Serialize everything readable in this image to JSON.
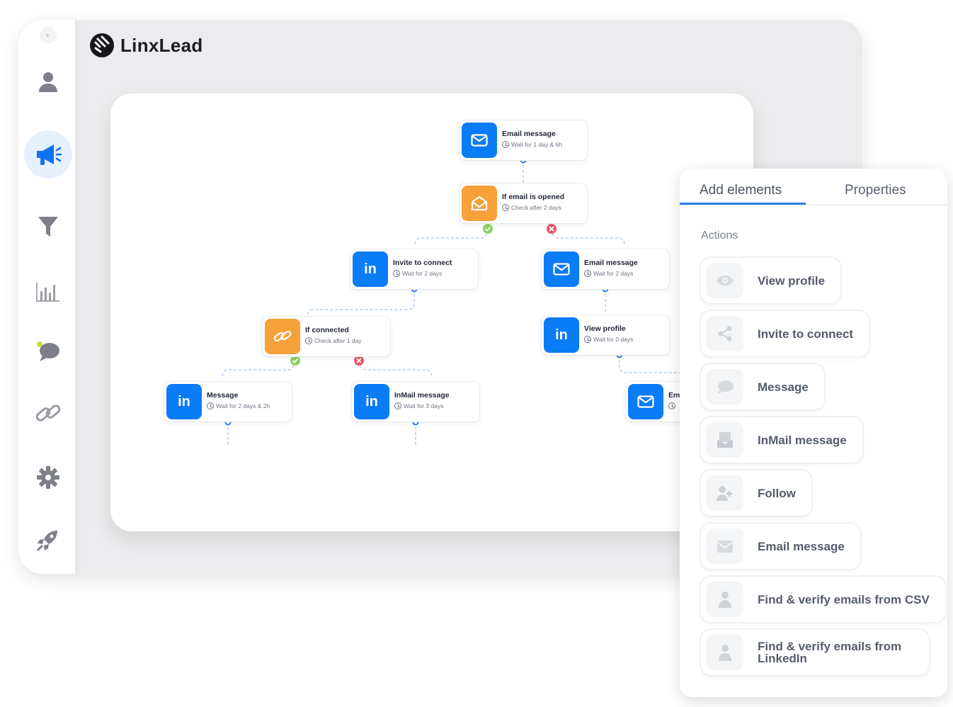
{
  "brand": {
    "name": "LinxLead"
  },
  "sidebar": {
    "items": [
      {
        "name": "contacts",
        "icon": "user-icon"
      },
      {
        "name": "campaigns",
        "icon": "megaphone-icon",
        "active": true
      },
      {
        "name": "filters",
        "icon": "filter-icon"
      },
      {
        "name": "analytics",
        "icon": "bar-chart-icon"
      },
      {
        "name": "messages",
        "icon": "chat-icon"
      },
      {
        "name": "integrations",
        "icon": "link-icon"
      },
      {
        "name": "settings",
        "icon": "gear-icon"
      },
      {
        "name": "launch",
        "icon": "rocket-icon"
      }
    ]
  },
  "flow": {
    "nodes": [
      {
        "title": "Email message",
        "subtitle": "Wait for 1 day & 6h",
        "icon": "envelope-icon",
        "color": "#0a7cf6"
      },
      {
        "title": "If email is opened",
        "subtitle": "Check after 2 days",
        "icon": "open-envelope-icon",
        "color": "#f8a03a"
      },
      {
        "title": "Invite to connect",
        "subtitle": "Wait for 2 days",
        "icon": "linkedin-icon",
        "color": "#0a7cf6"
      },
      {
        "title": "Email message",
        "subtitle": "Wait for 2 days",
        "icon": "envelope-icon",
        "color": "#0a7cf6"
      },
      {
        "title": "If connected",
        "subtitle": "Check after 1 day",
        "icon": "link-icon",
        "color": "#f8a03a"
      },
      {
        "title": "View profile",
        "subtitle": "Wait for 0 days",
        "icon": "linkedin-icon",
        "color": "#0a7cf6"
      },
      {
        "title": "Message",
        "subtitle": "Wait for 2 days & 2h",
        "icon": "linkedin-icon",
        "color": "#0a7cf6"
      },
      {
        "title": "InMail message",
        "subtitle": "Wait for 3 days",
        "icon": "linkedin-icon",
        "color": "#0a7cf6"
      },
      {
        "title": "Em",
        "subtitle": "",
        "icon": "envelope-icon",
        "color": "#0a7cf6"
      }
    ],
    "linkedin_glyph": "in",
    "yes_color": "#8dd35f",
    "no_color": "#e5576a"
  },
  "panel": {
    "tabs": [
      {
        "label": "Add elements",
        "active": true
      },
      {
        "label": "Properties",
        "active": false
      }
    ],
    "section_title": "Actions",
    "actions": [
      {
        "label": "View profile",
        "icon": "eye-icon"
      },
      {
        "label": "Invite to connect",
        "icon": "share-icon"
      },
      {
        "label": "Message",
        "icon": "chat-icon"
      },
      {
        "label": "InMail message",
        "icon": "inmail-icon"
      },
      {
        "label": "Follow",
        "icon": "follow-icon"
      },
      {
        "label": "Email message",
        "icon": "envelope-icon"
      },
      {
        "label": "Find & verify emails from CSV",
        "icon": "person-icon"
      },
      {
        "label": "Find & verify emails from LinkedIn",
        "icon": "person-icon"
      }
    ]
  }
}
